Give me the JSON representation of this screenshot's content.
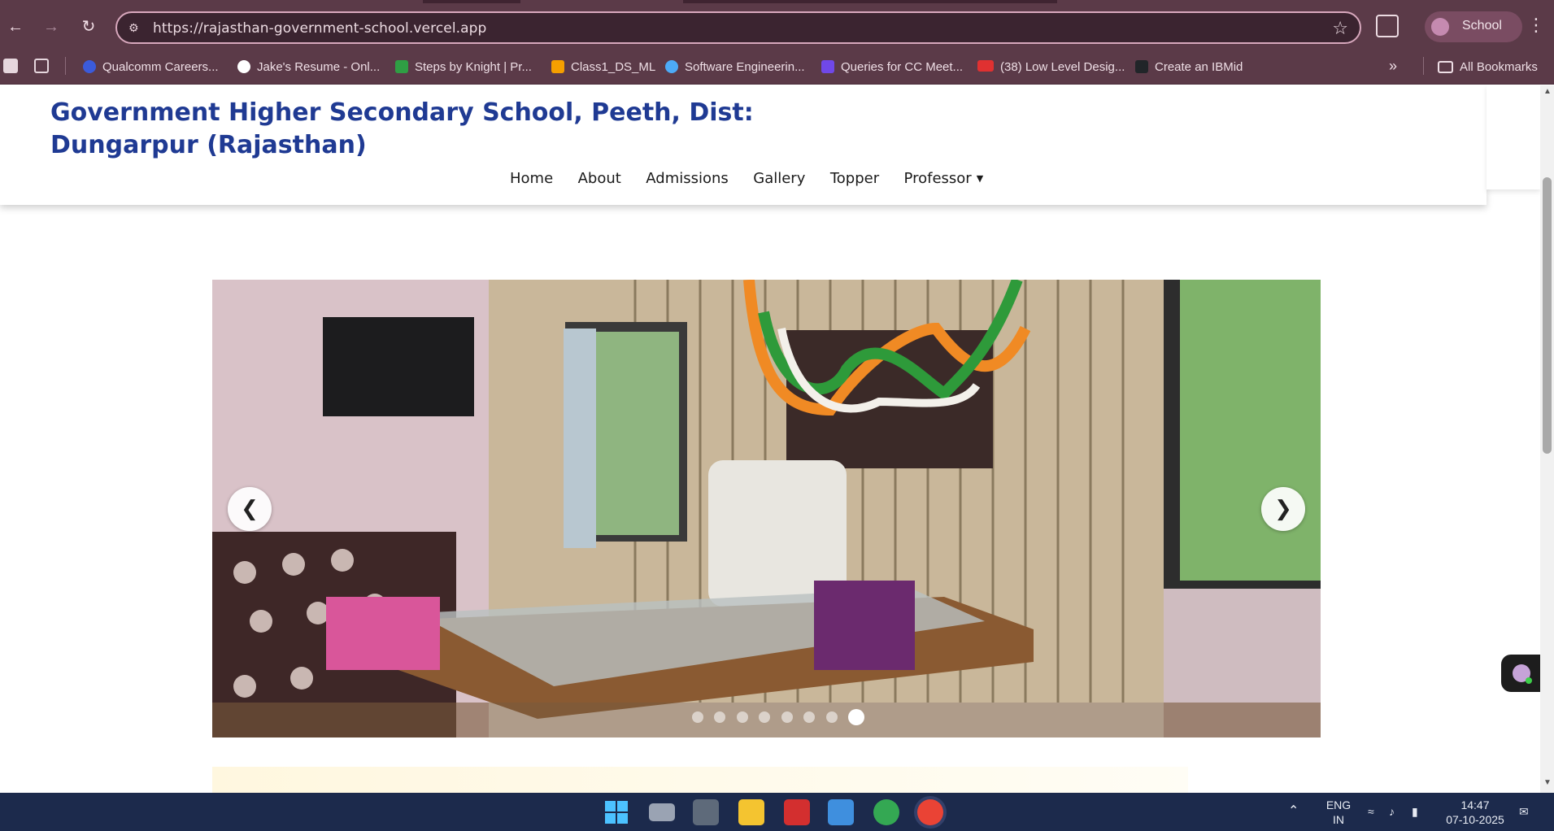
{
  "browser": {
    "url": "https://rajasthan-government-school.vercel.app",
    "profile_label": "School",
    "bookmarks": [
      {
        "label": "Qualcomm Careers...",
        "color": "#3b5bdb"
      },
      {
        "label": "Jake's Resume - Onl...",
        "color": "#ffffff"
      },
      {
        "label": "Steps by Knight | Pr...",
        "color": "#2f9e44"
      },
      {
        "label": "Class1_DS_ML",
        "color": "#f59f00"
      },
      {
        "label": "Software Engineerin...",
        "color": "#4dabf7"
      },
      {
        "label": "Queries for CC Meet...",
        "color": "#7048e8"
      },
      {
        "label": "(38) Low Level Desig...",
        "color": "#e03131"
      },
      {
        "label": "Create an IBMid",
        "color": "#212529"
      }
    ],
    "more_bookmarks_icon": "chevron-double-right",
    "all_bookmarks_label": "All Bookmarks"
  },
  "site": {
    "title": "Government Higher Secondary School, Peeth, Dist: Dungarpur (Rajasthan)",
    "nav": [
      {
        "label": "Home"
      },
      {
        "label": "About"
      },
      {
        "label": "Admissions"
      },
      {
        "label": "Gallery"
      },
      {
        "label": "Topper"
      },
      {
        "label": "Professor",
        "dropdown": true
      }
    ],
    "title_color": "#1f3a93"
  },
  "carousel": {
    "image_description": "principal office with desk, tricolour garland and TV",
    "slide_count": 8,
    "active_slide": 8,
    "prev_icon": "chevron-left",
    "next_icon": "chevron-right"
  },
  "taskbar": {
    "apps": [
      "windows-start",
      "task-view",
      "downloads",
      "file-explorer",
      "acrobat",
      "photos",
      "chrome",
      "chrome-profile"
    ],
    "language_top": "ENG",
    "language_bottom": "IN",
    "time": "14:47",
    "date": "07-10-2025"
  }
}
